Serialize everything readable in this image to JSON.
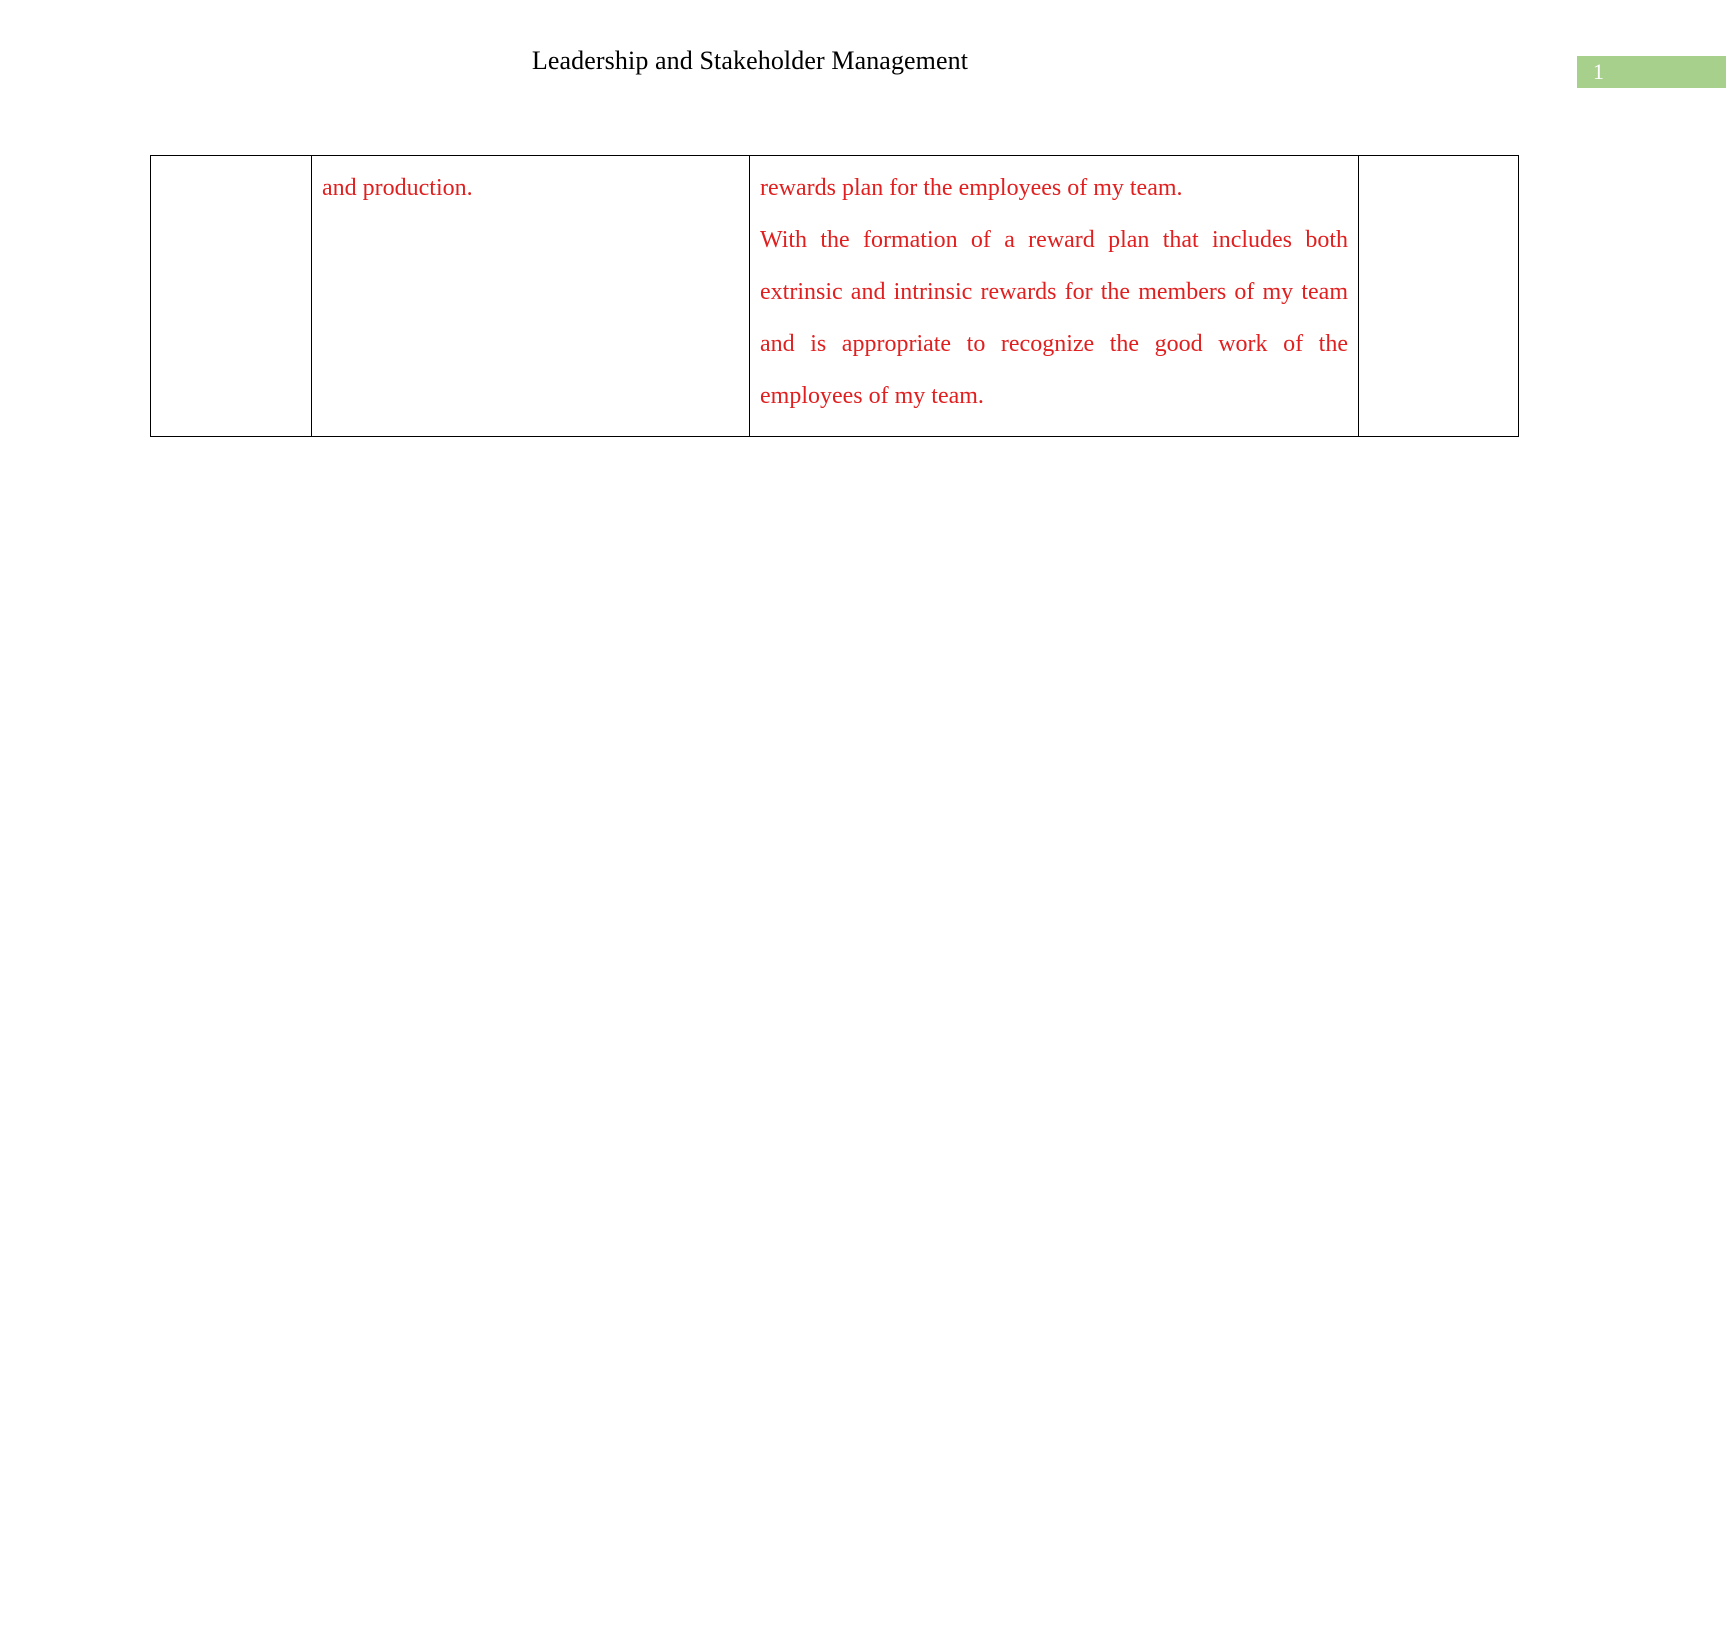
{
  "header": {
    "title": "Leadership and Stakeholder Management",
    "page_number": "1",
    "badge_color": "#a8d08d"
  },
  "colors": {
    "text_red": "#e02020",
    "text_black": "#000000",
    "border": "#000000",
    "page_badge_green": "#a8d08d"
  },
  "table": {
    "columns": 4,
    "rows": [
      {
        "cells": [
          {
            "text": "",
            "color": "",
            "empty": true
          },
          {
            "text": "and production.",
            "color": "#e02020",
            "empty": false
          },
          {
            "paragraphs": [
              "rewards plan for the employees of my team.",
              "With the formation of a reward plan that includes both extrinsic and intrinsic rewards for the members of my team and is appropriate to recognize the good work of the employees of my team."
            ],
            "color": "#e02020",
            "empty": false
          },
          {
            "text": "",
            "color": "",
            "empty": true
          }
        ]
      }
    ]
  },
  "cells": {
    "c1": "",
    "c2": "and production.",
    "c3_p1": "rewards plan for the employees of my team.",
    "c3_p2": "With the formation of a reward plan that includes both extrinsic and intrinsic rewards for the members of my team and is appropriate to recognize the good work of the employees of my team.",
    "c4": ""
  }
}
